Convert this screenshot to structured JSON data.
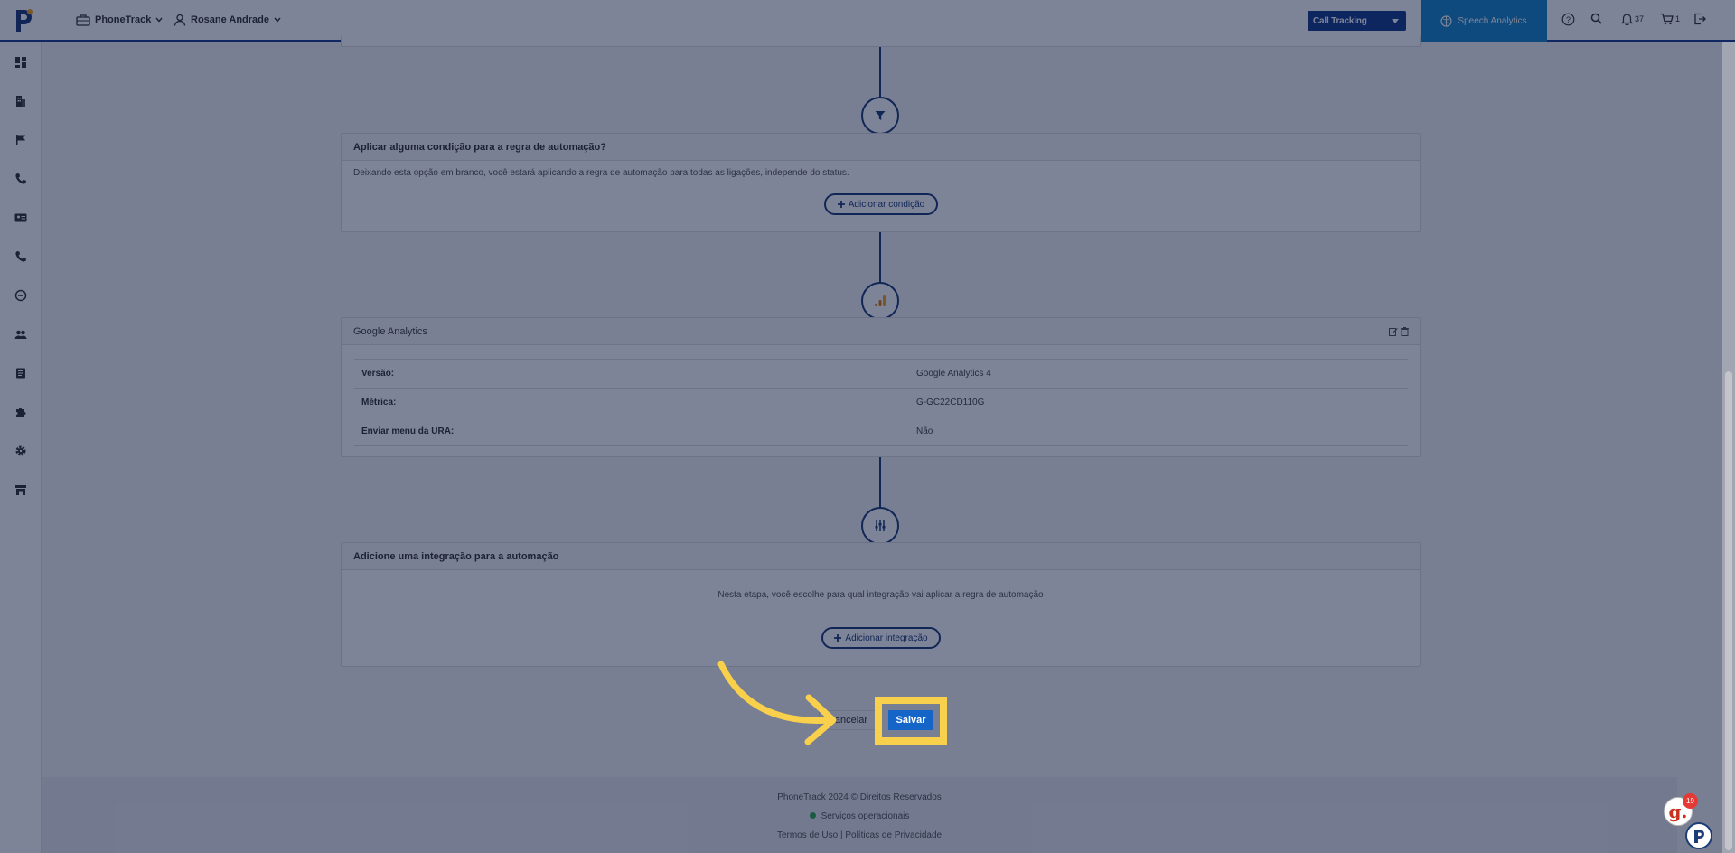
{
  "header": {
    "product_menu": "PhoneTrack",
    "user_menu": "Rosane Andrade",
    "call_tracking_label": "Call Tracking",
    "speech_analytics_label": "Speech Analytics",
    "notifications_count": "37",
    "cart_count": "1"
  },
  "sidebar": {
    "icons": [
      "dashboard-icon",
      "building-icon",
      "flag-icon",
      "phone-icon",
      "id-card-icon",
      "phone-call-icon",
      "minus-circle-icon",
      "users-icon",
      "book-icon",
      "puzzle-icon",
      "gear-icon",
      "store-icon"
    ]
  },
  "condition_card": {
    "title": "Aplicar alguma condição para a regra de automação?",
    "description": "Deixando esta opção em branco, você estará aplicando a regra de automação para todas as ligações, independe do status.",
    "add_button": "Adicionar condição"
  },
  "ga_card": {
    "title": "Google Analytics",
    "rows": [
      {
        "label": "Versão:",
        "value": "Google Analytics 4"
      },
      {
        "label": "Métrica:",
        "value": "G-GC22CD110G"
      },
      {
        "label": "Enviar menu da URA:",
        "value": "Não"
      }
    ]
  },
  "integration_card": {
    "title": "Adicione uma integração para a automação",
    "description": "Nesta etapa, você escolhe para qual integração vai aplicar a regra de automação",
    "add_button": "Adicionar integração"
  },
  "actions": {
    "cancel_label": "Cancelar",
    "save_label": "Salvar"
  },
  "footer": {
    "copyright": "PhoneTrack 2024 © Direitos Reservados",
    "status": "Serviços operacionais",
    "links": "Termos de Uso | Políticas de Privacidade"
  },
  "widgets": {
    "g_badge_count": "19"
  },
  "colors": {
    "primary_dark": "#163b8c",
    "speech_blue": "#1587c8",
    "save_blue": "#1565c8",
    "highlight": "#f9d04b",
    "status_green": "#2eaa4f"
  }
}
